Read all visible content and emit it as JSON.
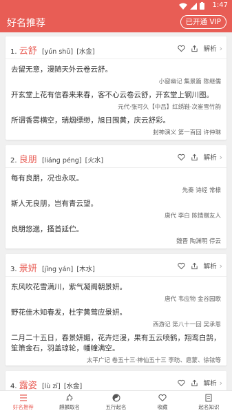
{
  "status_bar": {
    "time": "1:47",
    "icons": [
      "wifi-icon",
      "signal-icon",
      "battery-icon"
    ]
  },
  "header": {
    "title": "好名推荐",
    "vip_label": "已开通 VIP"
  },
  "colors": {
    "accent": "#e85d55",
    "background": "#f0f0f0"
  },
  "actions": {
    "favorite_icon": "heart-icon",
    "share_icon": "share-icon",
    "analyze_label": "解析"
  },
  "cards": [
    {
      "index": "1.",
      "name": "云舒",
      "pinyin": "[yún shū]",
      "wuxing": "[水金]",
      "entries": [
        {
          "quote": "去留无意，漫随天外云卷云舒。",
          "source": "小窗幽记 集景篇 陈继儒"
        },
        {
          "quote": "开玄堂上花有信春来来春，客不心云卷云舒，开玄堂上钢川图。",
          "source": "元代·张可久【中吕】红绣鞋·次崔雪竹韵"
        },
        {
          "quote": "所谓香雾横空，瑞烟缥缈，旭日围黄，庆云舒彩。",
          "source": "封神演义 第一百回 许仲琳"
        }
      ]
    },
    {
      "index": "2.",
      "name": "良朋",
      "pinyin": "[liáng péng]",
      "wuxing": "[火水]",
      "entries": [
        {
          "quote": "每有良朋，况也永叹。",
          "source": "先秦 诗经 常棣"
        },
        {
          "quote": "斯人无良朋，岂有青云望。",
          "source": "唐代 李白 陈情赠友人"
        },
        {
          "quote": "良朋悠邈，搔首延伫。",
          "source": "魏晋 陶渊明 停云"
        }
      ]
    },
    {
      "index": "3.",
      "name": "景妍",
      "pinyin": "[jǐng yán]",
      "wuxing": "[木水]",
      "entries": [
        {
          "quote": "东风吹花雪满川，紫气凝阁朝景妍。",
          "source": "唐代 韦应物 金谷园歌"
        },
        {
          "quote": "野花佳木知春发，杜宇黄莺应景妍。",
          "source": "西游记 第八十一回 吴承恩"
        },
        {
          "quote": "二月二十五日，春景妍媚，花卉烂漫，果有五云喷鹤，翔鸾白鹄，笙箫金石，羽盖琼轮，幡幢满空。",
          "source": "太平广记 卷五十三·神仙五十三 李昉、扈蒙、徐铉等"
        }
      ]
    },
    {
      "index": "4.",
      "name": "露姿",
      "pinyin": "[lù zī]",
      "wuxing": "[水金]",
      "entries": []
    }
  ],
  "bottom_nav": [
    {
      "label": "好名推荐",
      "icon": "list-icon",
      "active": true
    },
    {
      "label": "麒麟取名",
      "icon": "qilin-icon",
      "active": false
    },
    {
      "label": "五行起名",
      "icon": "yinyang-icon",
      "active": false
    },
    {
      "label": "收藏",
      "icon": "heart-icon",
      "active": false
    },
    {
      "label": "起名知识",
      "icon": "book-icon",
      "active": false
    }
  ]
}
